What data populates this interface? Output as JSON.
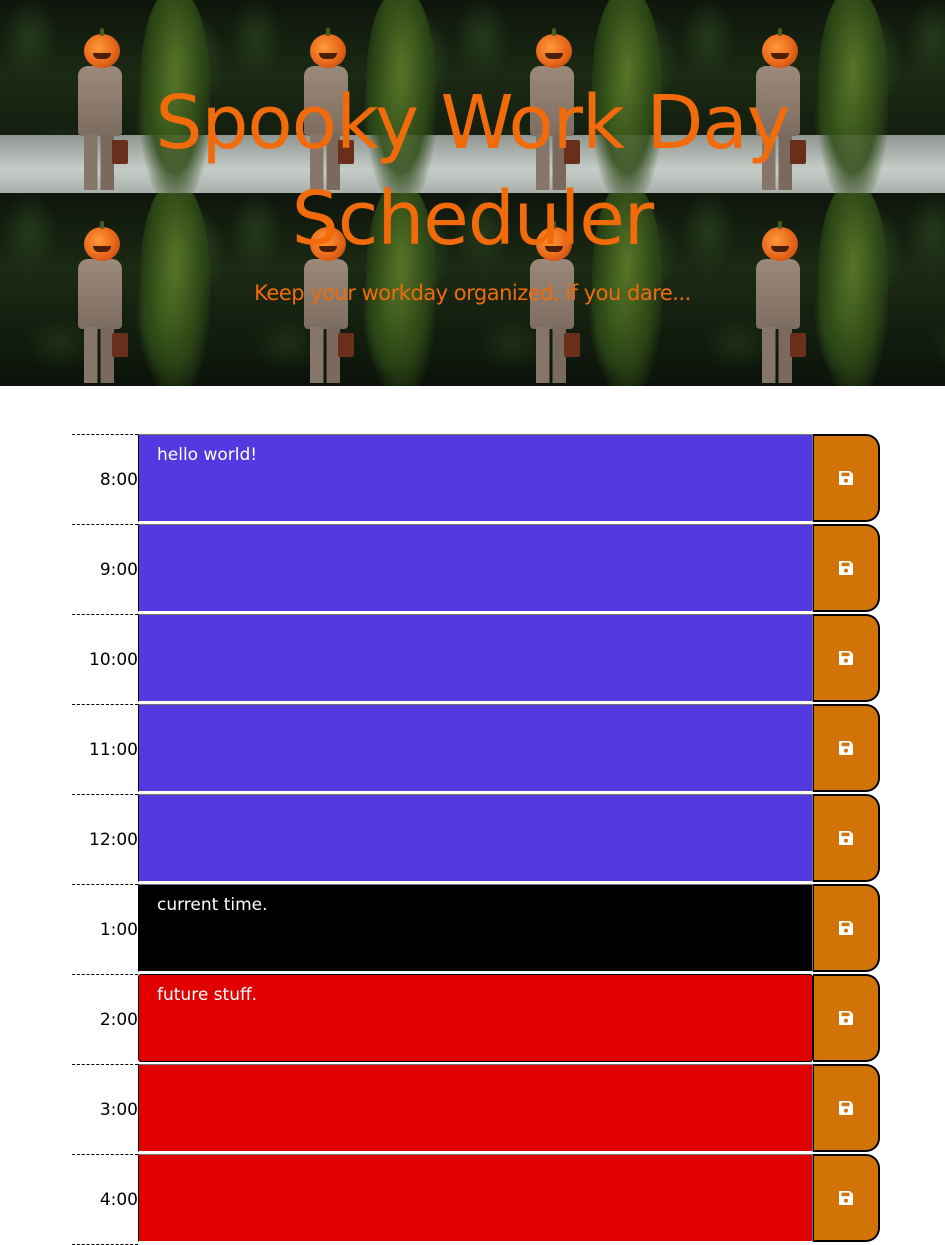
{
  "header": {
    "title": "Spooky Work Day Scheduler",
    "subtitle": "Keep your workday organized, if you dare..."
  },
  "schedule": [
    {
      "hour": "8:00",
      "text": "hello world!",
      "state": "past"
    },
    {
      "hour": "9:00",
      "text": "",
      "state": "past"
    },
    {
      "hour": "10:00",
      "text": "",
      "state": "past"
    },
    {
      "hour": "11:00",
      "text": "",
      "state": "past"
    },
    {
      "hour": "12:00",
      "text": "",
      "state": "past"
    },
    {
      "hour": "1:00",
      "text": "current time.",
      "state": "present"
    },
    {
      "hour": "2:00",
      "text": "future stuff.",
      "state": "future"
    },
    {
      "hour": "3:00",
      "text": "",
      "state": "future"
    },
    {
      "hour": "4:00",
      "text": "",
      "state": "future"
    }
  ],
  "colors": {
    "past": "#533ae0",
    "present": "#000000",
    "future": "#e00000",
    "save": "#d27307",
    "title": "#f26b0a"
  },
  "icons": {
    "save": "floppy-disk-icon"
  }
}
